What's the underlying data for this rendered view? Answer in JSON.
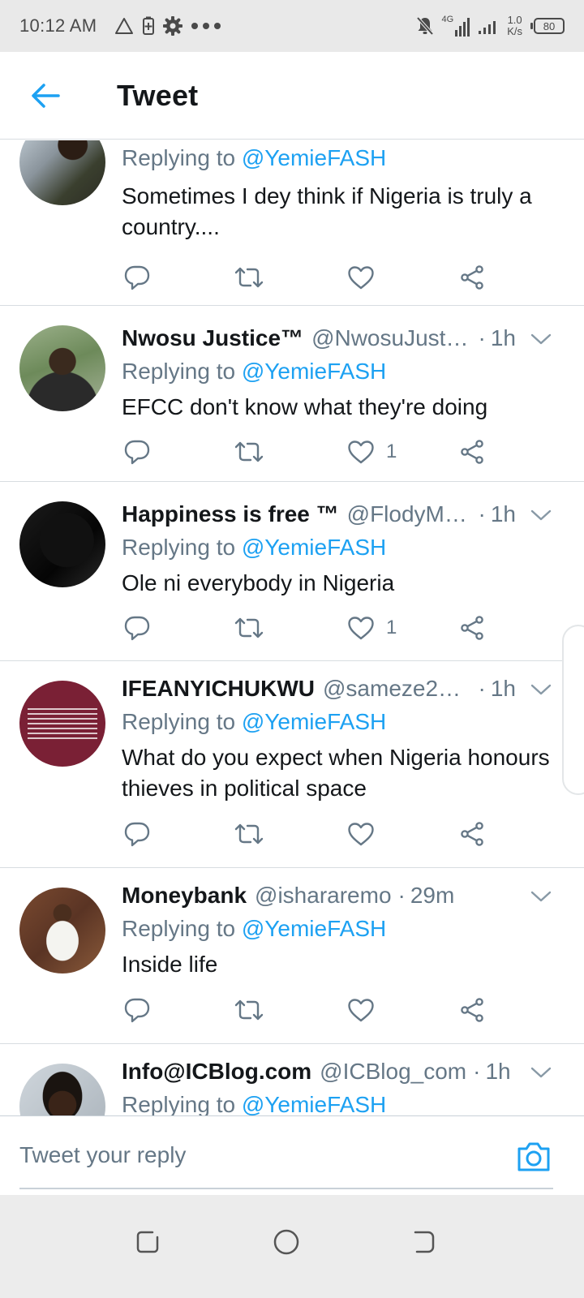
{
  "status_bar": {
    "time": "10:12 AM",
    "net_speed_value": "1.0",
    "net_speed_unit": "K/s",
    "network_type": "4G",
    "battery": "80"
  },
  "header": {
    "title": "Tweet"
  },
  "tweets": [
    {
      "name": "",
      "handle": "",
      "time": "",
      "replying_prefix": "Replying to",
      "replying_to": "@YemieFASH",
      "text": "Sometimes I dey think if Nigeria is truly a country....",
      "like_count": ""
    },
    {
      "name": "Nwosu Justice™",
      "handle": "@NwosuJusti…",
      "time": "1h",
      "replying_prefix": "Replying to",
      "replying_to": "@YemieFASH",
      "text": "EFCC don't know what they're doing",
      "like_count": "1"
    },
    {
      "name": "Happiness is free ™",
      "handle": "@FlodyM…",
      "time": "1h",
      "replying_prefix": "Replying to",
      "replying_to": "@YemieFASH",
      "text": "Ole ni everybody in Nigeria",
      "like_count": "1"
    },
    {
      "name": "IFEANYICHUKWU",
      "handle": "@sameze20…",
      "time": "1h",
      "replying_prefix": "Replying to",
      "replying_to": "@YemieFASH",
      "text": "What do you expect when Nigeria honours thieves in political space",
      "like_count": ""
    },
    {
      "name": "Moneybank",
      "handle": "@ishararemo",
      "time": "29m",
      "replying_prefix": "Replying to",
      "replying_to": "@YemieFASH",
      "text": "Inside life",
      "like_count": ""
    },
    {
      "name": "Info@ICBlog.com",
      "handle": "@ICBlog_com",
      "time": "1h",
      "replying_prefix": "Replying to",
      "replying_to": "@YemieFASH",
      "text": "",
      "like_count": ""
    }
  ],
  "reply_bar": {
    "placeholder": "Tweet your reply"
  },
  "colors": {
    "accent": "#1da1f2",
    "secondary_text": "#657786",
    "primary_text": "#14171a",
    "divider": "#d8dde1"
  }
}
